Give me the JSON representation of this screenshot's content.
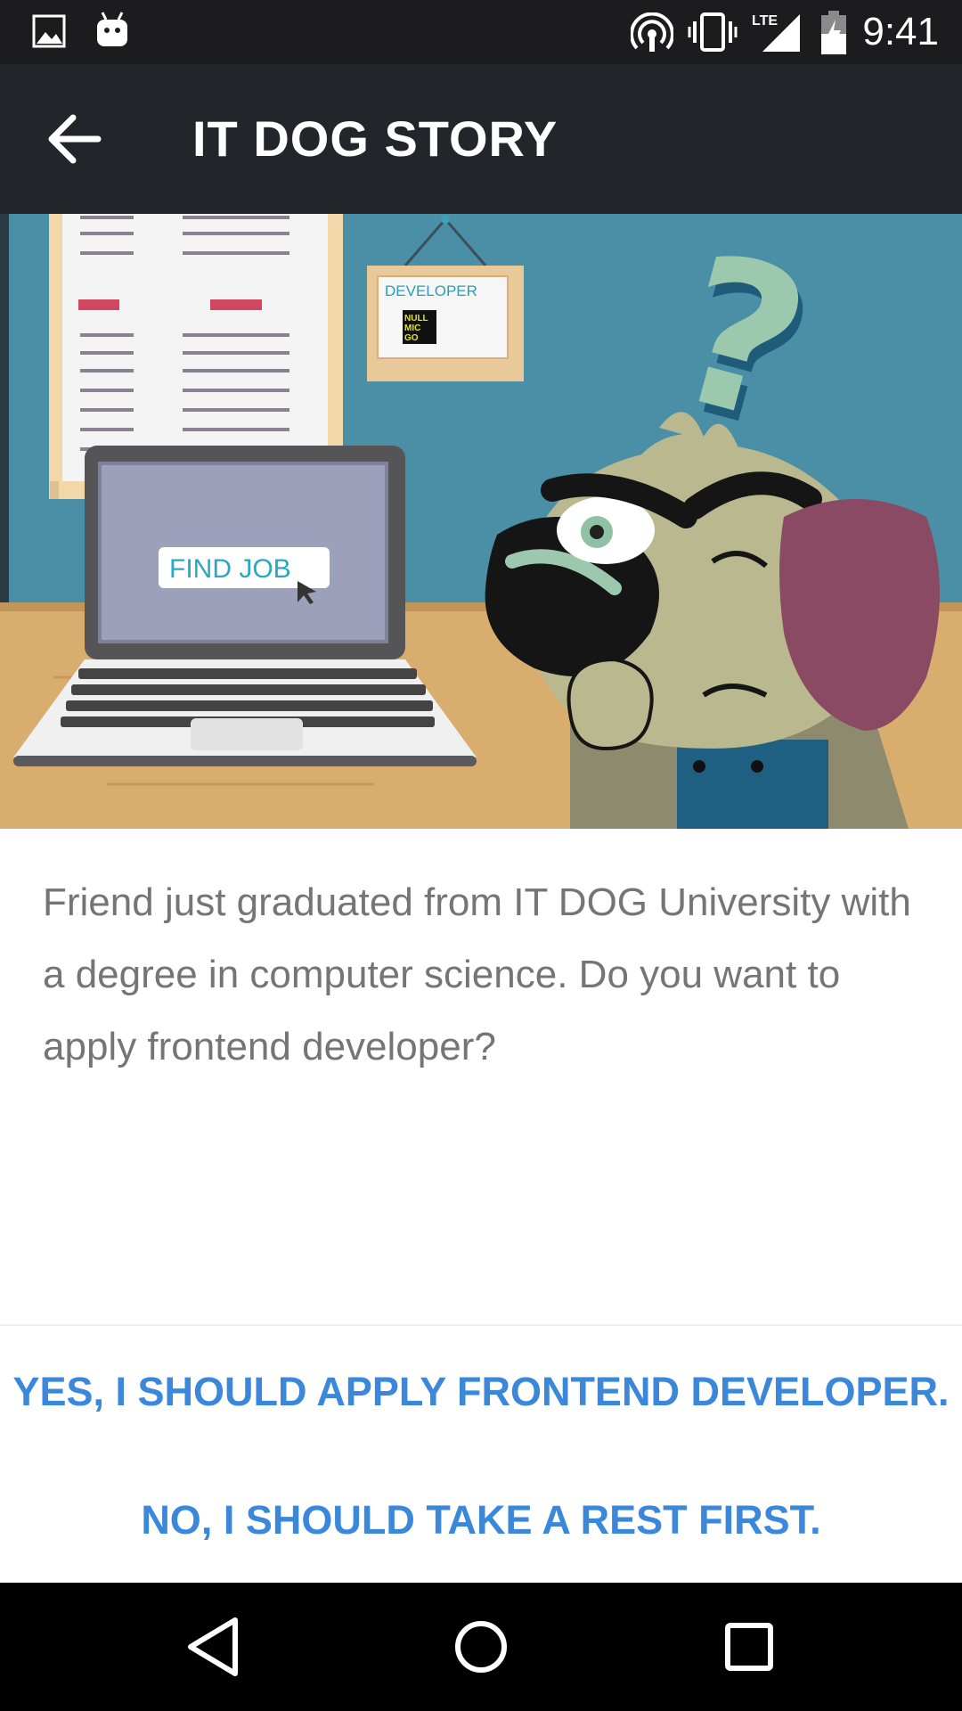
{
  "status_bar": {
    "time": "9:41",
    "network_label": "LTE",
    "icons": [
      "image-icon",
      "android-icon",
      "hotspot-icon",
      "vibrate-icon",
      "signal-icon",
      "battery-icon"
    ]
  },
  "app_bar": {
    "title": "IT DOG STORY",
    "back_icon": "arrow-back-icon"
  },
  "hero": {
    "sign_text": "DEVELOPER",
    "badge_lines": [
      "NULL",
      "MIC",
      "GO"
    ],
    "screen_button": "FIND JOB",
    "question_mark": "?"
  },
  "story": {
    "text": "Friend just graduated from IT DOG University with a degree in computer science. Do you want to apply frontend developer?"
  },
  "choices": {
    "yes": "YES, I SHOULD APPLY FRONTEND DEVELOPER.",
    "no": "NO, I SHOULD TAKE A REST FIRST."
  },
  "nav_bar": {
    "back": "nav-back-icon",
    "home": "nav-home-icon",
    "recents": "nav-recents-icon"
  },
  "colors": {
    "app_bar": "#22262b",
    "accent": "#3b87d9",
    "wall": "#4a8fa6",
    "desk": "#d9ad6e"
  }
}
